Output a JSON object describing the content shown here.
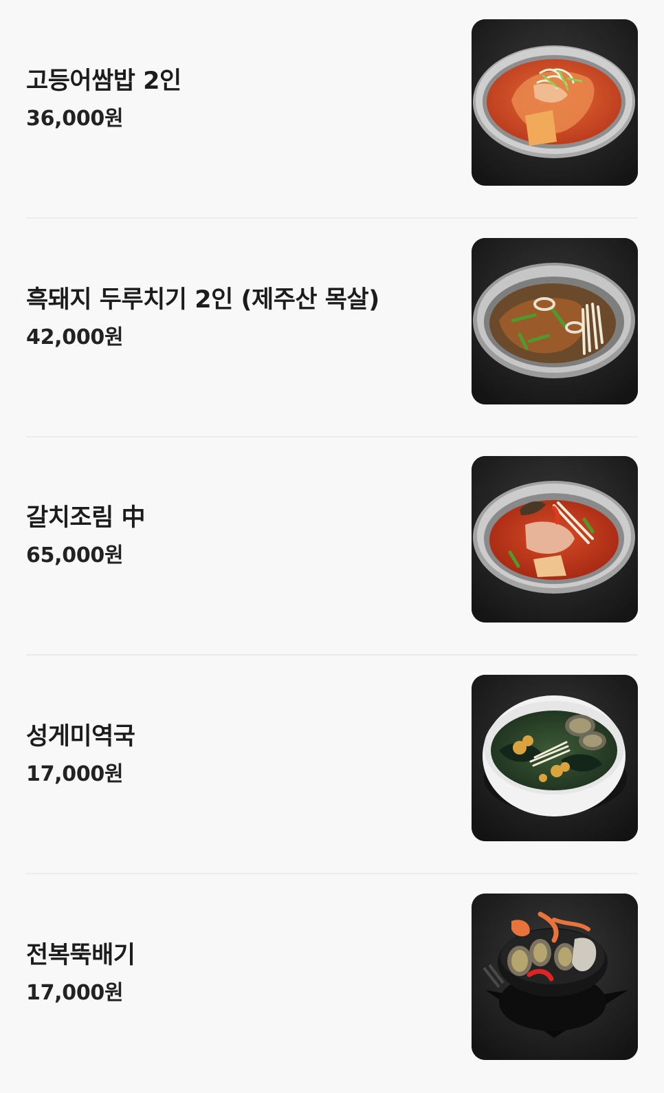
{
  "menu": {
    "items": [
      {
        "name": "고등어쌈밥 2인",
        "price": "36,000원",
        "icon": "kimchi-stew-icon"
      },
      {
        "name": "흑돼지 두루치기 2인 (제주산 목살)",
        "price": "42,000원",
        "icon": "pork-stir-fry-icon"
      },
      {
        "name": "갈치조림 中",
        "price": "65,000원",
        "icon": "braised-cutlassfish-icon"
      },
      {
        "name": "성게미역국",
        "price": "17,000원",
        "icon": "seaweed-soup-icon"
      },
      {
        "name": "전복뚝배기",
        "price": "17,000원",
        "icon": "abalone-hotpot-icon"
      }
    ]
  },
  "colors": {
    "background": "#f8f8f8",
    "divider": "#ececec",
    "text": "#1c1c1c",
    "photo_background": "#1f1f1f"
  }
}
